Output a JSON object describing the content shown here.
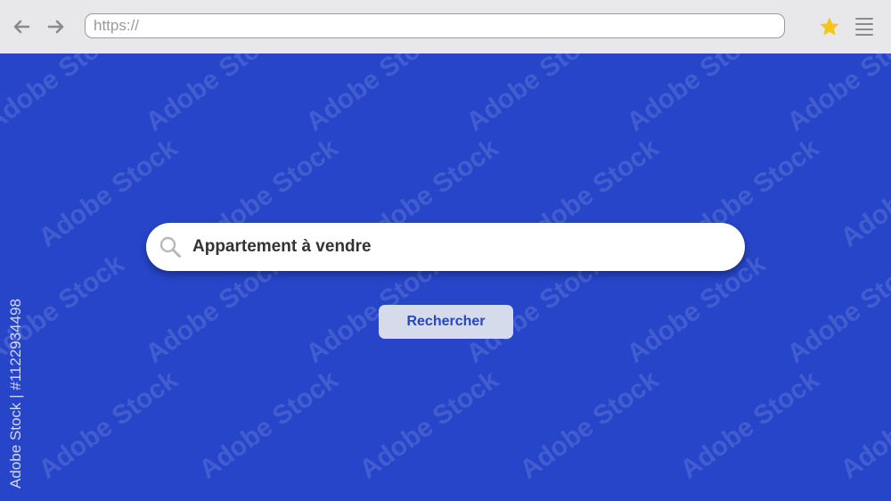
{
  "browser": {
    "address_bar": {
      "value": "https://",
      "placeholder": "https://"
    },
    "icons": {
      "back": "arrow-left-icon",
      "forward": "arrow-right-icon",
      "bookmark": "star-icon",
      "menu": "hamburger-menu-icon"
    },
    "colors": {
      "toolbar_bg": "#e8e8ea",
      "star": "#f5c518",
      "icon_gray": "#8a8a8a"
    }
  },
  "main": {
    "background_color": "#2645c8",
    "search": {
      "query": "Appartement à vendre",
      "icon": "search-icon"
    },
    "search_button": {
      "label": "Rechercher",
      "bg_color": "#d6dbec",
      "text_color": "#2645c8"
    }
  },
  "watermark": {
    "text": "Adobe Stock",
    "side_credit": "Adobe Stock | #1122934498"
  }
}
